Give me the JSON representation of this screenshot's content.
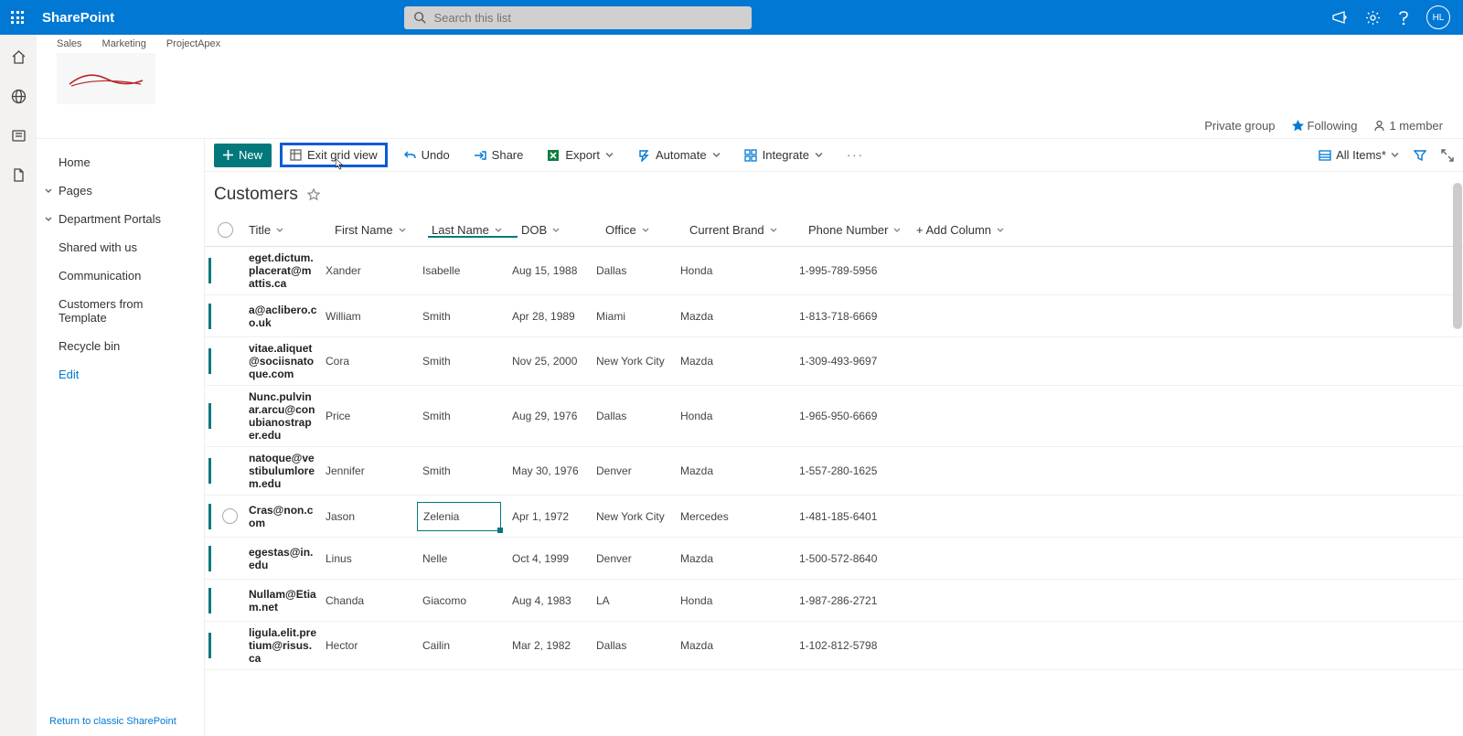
{
  "appName": "SharePoint",
  "search": {
    "placeholder": "Search this list"
  },
  "avatarInitials": "HL",
  "hubLinks": [
    "Sales",
    "Marketing",
    "ProjectApex"
  ],
  "siteMeta": {
    "privacy": "Private group",
    "followLabel": "Following",
    "memberLabel": "1 member"
  },
  "quickLaunch": {
    "home": "Home",
    "pages": "Pages",
    "dept": "Department Portals",
    "shared": "Shared with us",
    "comm": "Communication",
    "custTpl": "Customers from Template",
    "recycle": "Recycle bin",
    "edit": "Edit",
    "returnClassic": "Return to classic SharePoint"
  },
  "cmd": {
    "new": "New",
    "exit": "Exit grid view",
    "undo": "Undo",
    "share": "Share",
    "export": "Export",
    "automate": "Automate",
    "integrate": "Integrate",
    "allItems": "All Items*"
  },
  "list": {
    "title": "Customers"
  },
  "columns": {
    "title": "Title",
    "first": "First Name",
    "last": "Last Name",
    "dob": "DOB",
    "office": "Office",
    "brand": "Current Brand",
    "phone": "Phone Number",
    "add": "+ Add Column"
  },
  "rows": [
    {
      "title": "eget.dictum.placerat@mattis.ca",
      "first": "Xander",
      "last": "Isabelle",
      "dob": "Aug 15, 1988",
      "office": "Dallas",
      "brand": "Honda",
      "phone": "1-995-789-5956"
    },
    {
      "title": "a@aclibero.co.uk",
      "first": "William",
      "last": "Smith",
      "dob": "Apr 28, 1989",
      "office": "Miami",
      "brand": "Mazda",
      "phone": "1-813-718-6669"
    },
    {
      "title": "vitae.aliquet@sociisnatoque.com",
      "first": "Cora",
      "last": "Smith",
      "dob": "Nov 25, 2000",
      "office": "New York City",
      "brand": "Mazda",
      "phone": "1-309-493-9697"
    },
    {
      "title": "Nunc.pulvinar.arcu@conubianostraper.edu",
      "first": "Price",
      "last": "Smith",
      "dob": "Aug 29, 1976",
      "office": "Dallas",
      "brand": "Honda",
      "phone": "1-965-950-6669"
    },
    {
      "title": "natoque@vestibulumlorem.edu",
      "first": "Jennifer",
      "last": "Smith",
      "dob": "May 30, 1976",
      "office": "Denver",
      "brand": "Mazda",
      "phone": "1-557-280-1625"
    },
    {
      "title": "Cras@non.com",
      "first": "Jason",
      "last": "Zelenia",
      "dob": "Apr 1, 1972",
      "office": "New York City",
      "brand": "Mercedes",
      "phone": "1-481-185-6401",
      "editing": true,
      "showSel": true
    },
    {
      "title": "egestas@in.edu",
      "first": "Linus",
      "last": "Nelle",
      "dob": "Oct 4, 1999",
      "office": "Denver",
      "brand": "Mazda",
      "phone": "1-500-572-8640"
    },
    {
      "title": "Nullam@Etiam.net",
      "first": "Chanda",
      "last": "Giacomo",
      "dob": "Aug 4, 1983",
      "office": "LA",
      "brand": "Honda",
      "phone": "1-987-286-2721"
    },
    {
      "title": "ligula.elit.pretium@risus.ca",
      "first": "Hector",
      "last": "Cailin",
      "dob": "Mar 2, 1982",
      "office": "Dallas",
      "brand": "Mazda",
      "phone": "1-102-812-5798"
    }
  ]
}
